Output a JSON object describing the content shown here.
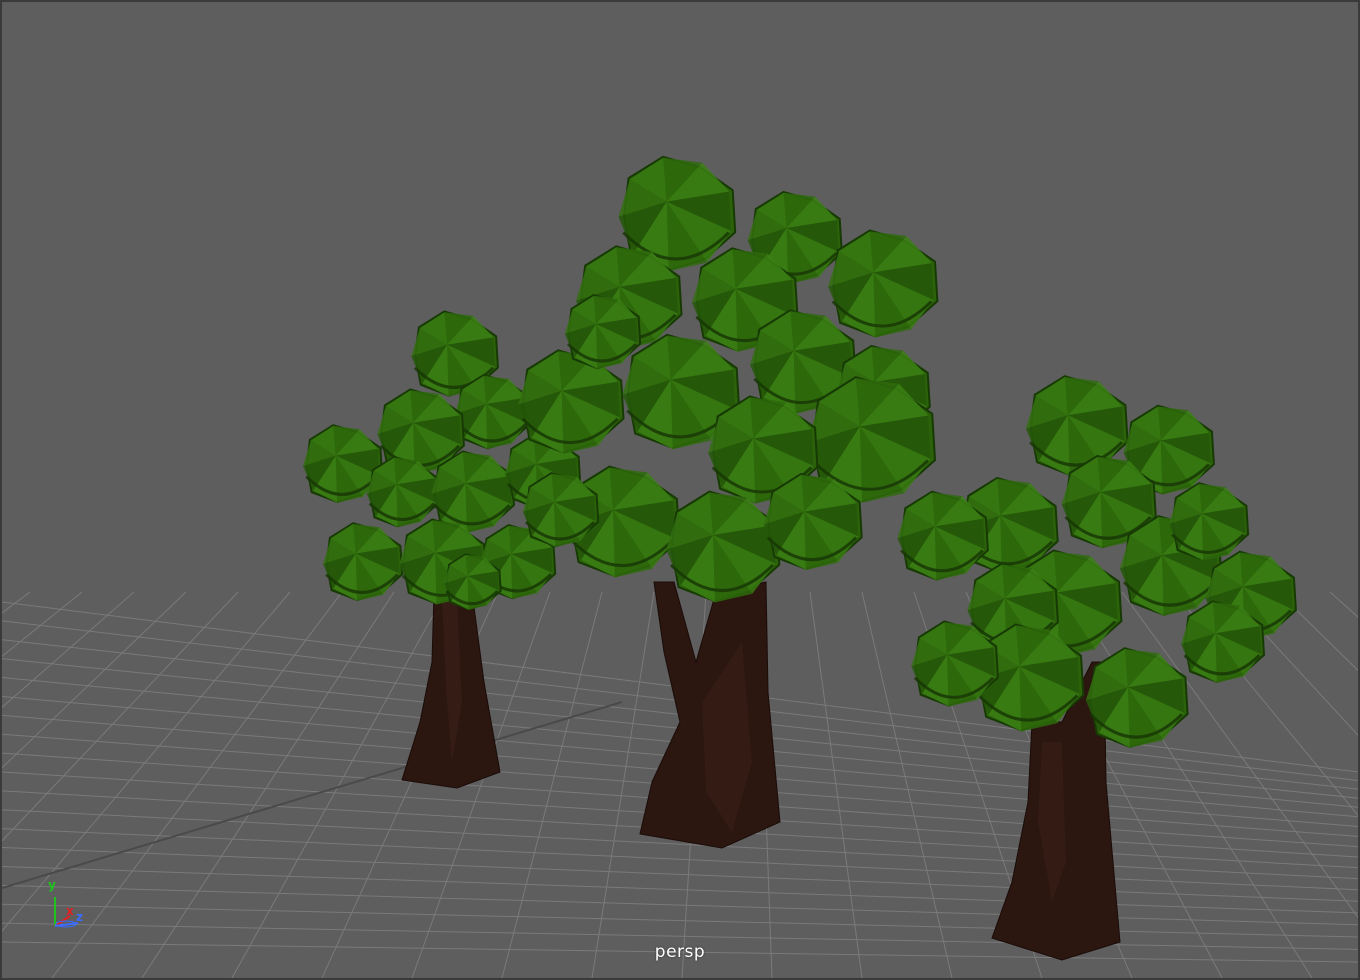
{
  "viewport": {
    "camera_label": "persp",
    "axes": {
      "y": "y",
      "x": "x",
      "z": "z"
    },
    "colors": {
      "background": "#5e5e5e",
      "grid": "#7a7a7a",
      "foliage": "#2f6a0a",
      "trunk": "#2a1510",
      "axis_y": "#1ec31e",
      "axis_x": "#e02020",
      "axis_z": "#3a6cff"
    }
  }
}
